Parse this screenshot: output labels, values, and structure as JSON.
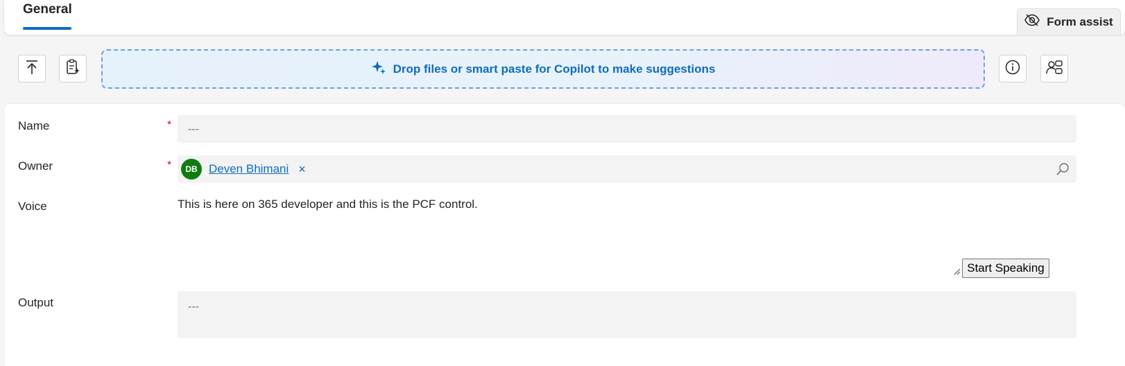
{
  "tabs": {
    "general": "General"
  },
  "form_assist": {
    "label": "Form assist",
    "icon": "eye-off-icon"
  },
  "toolbar": {
    "upload_icon": "arrow-up-to-line-icon",
    "paste_icon": "document-sparkle-icon",
    "dropzone_text": "Drop files or smart paste for Copilot to make suggestions",
    "dropzone_icon": "sparkle-icon",
    "info_icon": "info-icon",
    "share_icon": "people-settings-icon"
  },
  "form": {
    "name": {
      "label": "Name",
      "required_mark": "*",
      "placeholder": "---"
    },
    "owner": {
      "label": "Owner",
      "required_mark": "*",
      "initials": "DB",
      "value": "Deven Bhimani",
      "remove": "×",
      "avatar_color": "#107c10"
    },
    "voice": {
      "label": "Voice",
      "text": "This is here on 365 developer and this is the PCF control.",
      "button": "Start Speaking"
    },
    "output": {
      "label": "Output",
      "placeholder": "---"
    }
  },
  "colors": {
    "accent": "#0f6cbd",
    "required": "#c50f1f",
    "field_bg": "#f3f3f3"
  }
}
